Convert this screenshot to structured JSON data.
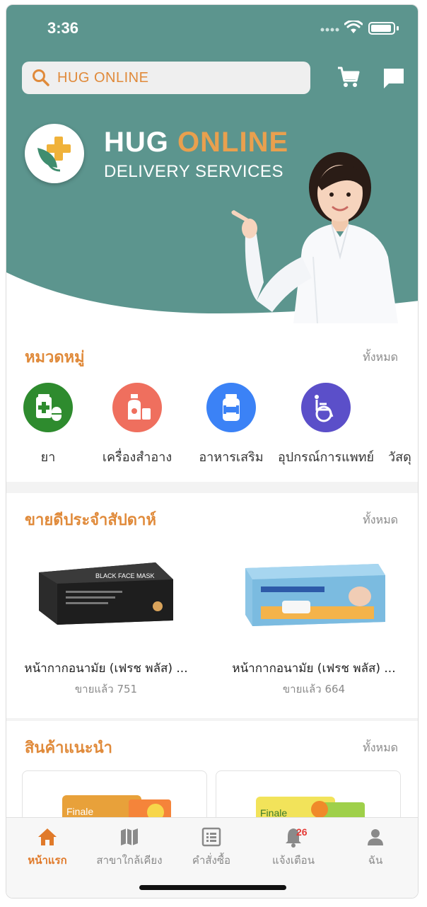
{
  "status_bar": {
    "time": "3:36"
  },
  "search": {
    "placeholder": "HUG ONLINE"
  },
  "banner": {
    "title_part1": "HUG",
    "title_part2": "ONLINE",
    "subtitle": "DELIVERY SERVICES"
  },
  "categories": {
    "title": "หมวดหมู่",
    "see_all": "ทั้งหมด",
    "items": [
      {
        "label": "ยา",
        "icon": "medicine-icon",
        "color": "#2e8b2e"
      },
      {
        "label": "เครื่องสำอาง",
        "icon": "cosmetics-icon",
        "color": "#ef6f5e"
      },
      {
        "label": "อาหารเสริม",
        "icon": "supplement-icon",
        "color": "#3b82f6"
      },
      {
        "label": "อุปกรณ์การแพทย์",
        "icon": "wheelchair-icon",
        "color": "#5b4fc9"
      },
      {
        "label": "วัสดุ",
        "icon": "supplies-icon",
        "color": "#999999"
      }
    ]
  },
  "bestseller": {
    "title": "ขายดีประจำสัปดาห์",
    "see_all": "ทั้งหมด",
    "products": [
      {
        "name": "หน้ากากอนามัย (เฟรช พลัส) ...",
        "sold": "ขายแล้ว 751",
        "box_text": "BLACK FACE MASK"
      },
      {
        "name": "หน้ากากอนามัย (เฟรช พลัส) ...",
        "sold": "ขายแล้ว 664"
      }
    ]
  },
  "recommend": {
    "title": "สินค้าแนะนำ",
    "see_all": "ทั้งหมด",
    "cards": [
      {
        "label": "Finale"
      },
      {
        "label": "Finale"
      }
    ]
  },
  "tabbar": {
    "tabs": [
      {
        "label": "หน้าแรก",
        "icon": "home-icon",
        "active": true
      },
      {
        "label": "สาขาใกล้เคียง",
        "icon": "map-icon",
        "active": false
      },
      {
        "label": "คำสั่งซื้อ",
        "icon": "order-list-icon",
        "active": false
      },
      {
        "label": "แจ้งเตือน",
        "icon": "bell-icon",
        "active": false,
        "badge": "26"
      },
      {
        "label": "ฉัน",
        "icon": "user-icon",
        "active": false
      }
    ]
  },
  "colors": {
    "teal": "#5c958e",
    "accent": "#e08a3a",
    "active_tab": "#e07a2a"
  }
}
